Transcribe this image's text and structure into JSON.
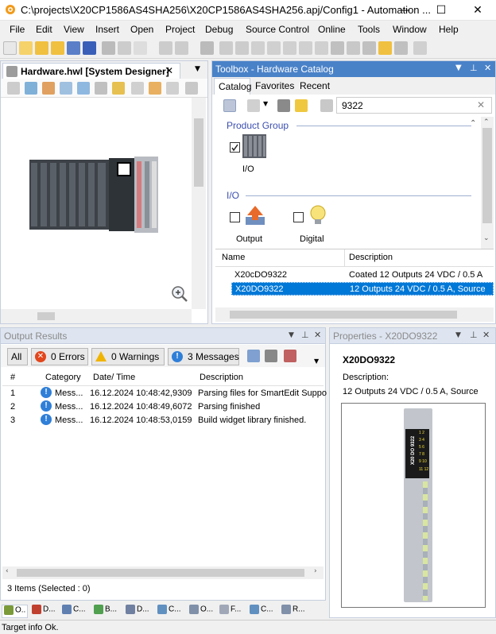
{
  "window": {
    "title": "C:\\projects\\X20CP1586AS4SHA256\\X20CP1586AS4SHA256.apj/Config1 - Automation ...",
    "minimize_glyph": "—",
    "maximize_glyph": "☐",
    "close_glyph": "✕"
  },
  "menu": [
    "File",
    "Edit",
    "View",
    "Insert",
    "Open",
    "Project",
    "Debug",
    "Source Control",
    "Online",
    "Tools",
    "Window",
    "Help"
  ],
  "hardware_panel": {
    "tab_label": "Hardware.hwl [System Designer]",
    "close_glyph": "✕",
    "dropdown_glyph": "▼",
    "zoom_icon": "magnifier-plus-icon"
  },
  "toolbox": {
    "header": "Toolbox - Hardware Catalog",
    "tabs": [
      "Catalog",
      "Favorites",
      "Recent"
    ],
    "search_value": "9322",
    "clear_glyph": "✕",
    "product_group_label": "Product Group",
    "io_label": "I/O",
    "items": [
      {
        "label": "I/O",
        "checked": true,
        "icon": "io-modules-icon"
      },
      {
        "label": "Output",
        "checked": false,
        "icon": "output-arrow-icon"
      },
      {
        "label": "Digital",
        "checked": false,
        "icon": "lightbulb-icon"
      }
    ],
    "columns": [
      "Name",
      "Description"
    ],
    "results": [
      {
        "name": "X20cDO9322",
        "description": "Coated 12 Outputs 24 VDC /  0.5 A",
        "selected": false
      },
      {
        "name": "X20DO9322",
        "description": "12 Outputs 24 VDC /  0.5 A, Source",
        "selected": true
      }
    ]
  },
  "output_results": {
    "header": "Output Results",
    "filters": {
      "all": "All",
      "errors": "0 Errors",
      "warnings": "0 Warnings",
      "messages": "3 Messages"
    },
    "columns": [
      "#",
      "Category",
      "Date/ Time",
      "Description"
    ],
    "rows": [
      {
        "num": "1",
        "category": "Mess...",
        "datetime": "16.12.2024 10:48:42,9309",
        "description": "Parsing files for SmartEdit Suppo"
      },
      {
        "num": "2",
        "category": "Mess...",
        "datetime": "16.12.2024 10:48:49,6072",
        "description": "Parsing finished"
      },
      {
        "num": "3",
        "category": "Mess...",
        "datetime": "16.12.2024 10:48:53,0159",
        "description": "Build widget library finished."
      }
    ],
    "footer": "3 Items (Selected : 0)"
  },
  "properties": {
    "header": "Properties - X20DO9322",
    "name": "X20DO9322",
    "description_label": "Description:",
    "description_value": "12 Outputs 24 VDC / 0.5 A, Source",
    "module_label": "X20 DO 9322",
    "channel_numbers": [
      "1  2",
      "3  4",
      "5  6",
      "7  8",
      "9 10",
      "11 12"
    ]
  },
  "bottom_tabs": [
    "O..",
    "D...",
    "C...",
    "B...",
    "D...",
    "C...",
    "O...",
    "F...",
    "C...",
    "R..."
  ],
  "status": "Target info Ok.",
  "colors": {
    "selection": "#0078d7",
    "panel_header": "#dee5f0",
    "accent_group": "#3c4fb0"
  }
}
